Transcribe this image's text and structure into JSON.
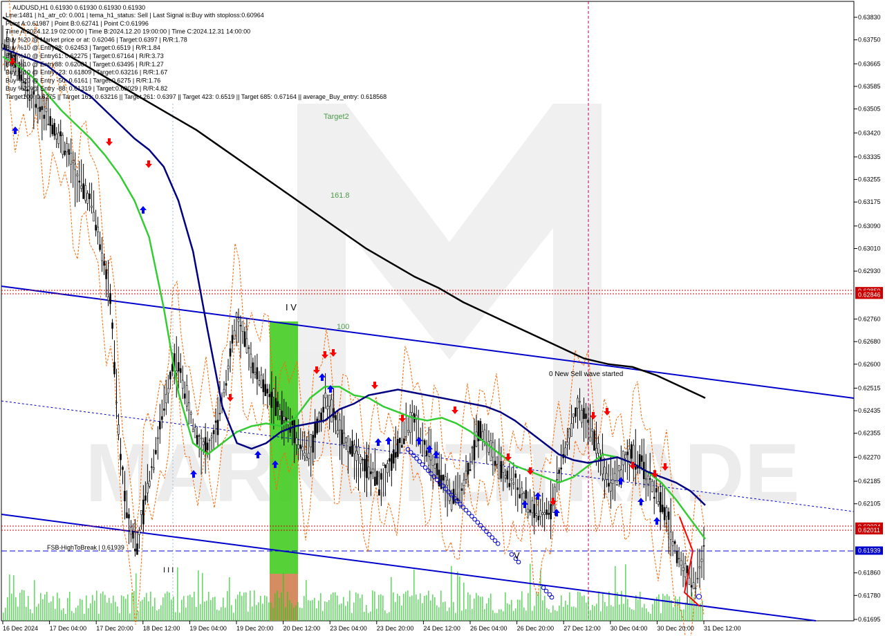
{
  "chart_data": {
    "type": "line",
    "symbol": "AUDUSD,H1",
    "title": "AUDUSD,H1  0.61930 0.61930 0.61930 0.61930",
    "info_lines": [
      "Line:1481 | h1_atr_c0: 0.001 | tema_h1_status: Sell | Last Signal is:Buy with stoploss:0.60964",
      "Point A:0.61987 | Point B:0.62741 | Point C:0.61996",
      "Time A:2024.12.19 02:00:00 | Time B:2024.12.20 19:00:00 | Time C:2024.12.31 14:00:00",
      "Buy %20 @ Market price or at: 0.62046 | Target:0.6397 | R/R:1.78",
      "Buy %10 @ Entry38: 0.62453 | Target:0.6519 | R/R:1.84",
      "Buy %10 @ Entry61: 0.62275 | Target:0.67164 | R/R:3.73",
      "Buy %10 @ Entry88: 0.62081 | Target:0.63495 | R/R:1.27",
      "Buy %10 @ Entry -23: 0.61809 | Target:0.63216 | R/R:1.67",
      "Buy %20 @ Entry -50: 0.6161 | Target:0.6275 | R/R:1.76",
      "Buy %20 @ Entry -88: 0.61319 | Target:0.63029 | R/R:4.82",
      "Target100: 0.6275 || Target 161: 0.63216 || Target 261: 0.6397 || Target 423: 0.6519 || Target 685: 0.67164 || average_Buy_entry: 0.618568"
    ],
    "y_ticks": [
      0.6383,
      0.6375,
      0.63665,
      0.63585,
      0.63505,
      0.6342,
      0.63335,
      0.63255,
      0.63175,
      0.6309,
      0.6301,
      0.6293,
      0.6276,
      0.6268,
      0.626,
      0.62515,
      0.62435,
      0.62355,
      0.6227,
      0.62185,
      0.62105,
      0.6186,
      0.6178,
      0.61695
    ],
    "y_tick_labels": [
      "0.63830",
      "0.63750",
      "0.63665",
      "0.63585",
      "0.63505",
      "0.63420",
      "0.63335",
      "0.63255",
      "0.63175",
      "0.63090",
      "0.63010",
      "0.62930",
      "0.62760",
      "0.62680",
      "0.62600",
      "0.62515",
      "0.62435",
      "0.62355",
      "0.62270",
      "0.62185",
      "0.62105",
      "0.61860",
      "0.61780",
      "0.61695"
    ],
    "ylim": [
      0.6169,
      0.6388
    ],
    "x_labels": [
      "16 Dec 2024",
      "17 Dec 04:00",
      "17 Dec 20:00",
      "18 Dec 12:00",
      "19 Dec 04:00",
      "19 Dec 20:00",
      "20 Dec 12:00",
      "23 Dec 04:00",
      "23 Dec 20:00",
      "24 Dec 12:00",
      "26 Dec 04:00",
      "26 Dec 20:00",
      "27 Dec 12:00",
      "30 Dec 04:00",
      "30 Dec 20:00",
      "31 Dec 12:00"
    ],
    "price_tags": [
      {
        "value": 0.62859,
        "label": "0.62859",
        "color": "#cc0000"
      },
      {
        "value": 0.62846,
        "label": "0.62846",
        "color": "#cc0000"
      },
      {
        "value": 0.62024,
        "label": "0.62024",
        "color": "#cc0000"
      },
      {
        "value": 0.62011,
        "label": "0.62011",
        "color": "#cc0000"
      },
      {
        "value": 0.61939,
        "label": "0.61939",
        "color": "#0000cc"
      }
    ],
    "annotations": {
      "target2": "Target2",
      "fib161": "161.8",
      "fib100": "100",
      "wave_iv": "I V",
      "wave_iii": "I I I",
      "wave_v": "V",
      "sell_wave": "0 New Sell wave started",
      "fsb": "FSB-HighToBreak | 0.61939"
    },
    "series": [
      {
        "values": [
          0.6372,
          0.637,
          0.6368,
          0.6366,
          0.6362,
          0.6358,
          0.6355,
          0.635,
          0.6345,
          0.634,
          0.6336,
          0.633,
          0.6318,
          0.63,
          0.6272,
          0.6245,
          0.6232,
          0.623,
          0.6232,
          0.6236,
          0.6238,
          0.6239,
          0.624,
          0.6244,
          0.6246,
          0.6249,
          0.625,
          0.6251,
          0.625,
          0.6249,
          0.6248,
          0.6247,
          0.6246,
          0.6245,
          0.6243,
          0.624,
          0.6236,
          0.6232,
          0.6228,
          0.6226,
          0.6225,
          0.6226,
          0.6227,
          0.6225,
          0.6222,
          0.622,
          0.6218,
          0.6215,
          0.621
        ]
      },
      {
        "values": [
          0.6369,
          0.6366,
          0.6362,
          0.6356,
          0.635,
          0.6345,
          0.634,
          0.6334,
          0.6327,
          0.6318,
          0.6305,
          0.628,
          0.625,
          0.6232,
          0.6228,
          0.6232,
          0.6236,
          0.6238,
          0.6239,
          0.6238,
          0.6241,
          0.6248,
          0.6252,
          0.6252,
          0.6249,
          0.6248,
          0.6245,
          0.6243,
          0.6241,
          0.624,
          0.6241,
          0.6239,
          0.6236,
          0.6232,
          0.6228,
          0.6224,
          0.6222,
          0.622,
          0.6218,
          0.622,
          0.6224,
          0.6228,
          0.6227,
          0.6225,
          0.6222,
          0.6218,
          0.6212,
          0.6205,
          0.6198
        ]
      },
      {
        "values": [
          0.6383,
          0.6378,
          0.6373,
          0.6368,
          0.6363,
          0.6358,
          0.6353,
          0.6348,
          0.6343,
          0.6337,
          0.6331,
          0.6325,
          0.6319,
          0.6313,
          0.6307,
          0.6301,
          0.6296,
          0.6291,
          0.6287,
          0.6282,
          0.6278,
          0.6274,
          0.627,
          0.6266,
          0.6262,
          0.626,
          0.6259,
          0.6256,
          0.6252,
          0.6248
        ]
      },
      {
        "values": [
          0.6374,
          0.6368,
          0.6362,
          0.6356,
          0.6352,
          0.6348,
          0.6342,
          0.6336,
          0.6328,
          0.6322,
          0.6316,
          0.63,
          0.6282,
          0.623,
          0.6205,
          0.6195,
          0.6215,
          0.623,
          0.6245,
          0.6262,
          0.6255,
          0.624,
          0.6232,
          0.623,
          0.624,
          0.6258,
          0.6275,
          0.6268,
          0.6258,
          0.6252,
          0.6248,
          0.6242,
          0.6238,
          0.6232,
          0.6228,
          0.6238,
          0.6248,
          0.624,
          0.6232,
          0.623,
          0.6225,
          0.6222,
          0.6218,
          0.6224,
          0.623,
          0.6238,
          0.624,
          0.623,
          0.6224,
          0.6218,
          0.6212,
          0.6215,
          0.6225,
          0.6238,
          0.6232,
          0.6225,
          0.622,
          0.6218,
          0.6212,
          0.6208,
          0.6205,
          0.621,
          0.6222,
          0.6235,
          0.6244,
          0.624,
          0.6232,
          0.6222,
          0.6218,
          0.6225,
          0.6228,
          0.6225,
          0.6218,
          0.6212,
          0.6205,
          0.6192,
          0.6186,
          0.6182,
          0.6193
        ]
      }
    ],
    "grid": false,
    "legend": "none",
    "colors": {
      "tema": "#000080",
      "ma_green": "#33cc33",
      "ma_black": "#000000",
      "channel": "#0000cc",
      "price": "#000000",
      "volume": "#22cc22",
      "fib_zone": "#44cc22",
      "fib_zone_low": "#d08050",
      "sell_arrow": "#ff0000",
      "buy_arrow": "#0000ff",
      "red_level": "#cc0000",
      "orange_band": "#ff6600",
      "vline": "#c00060"
    }
  }
}
